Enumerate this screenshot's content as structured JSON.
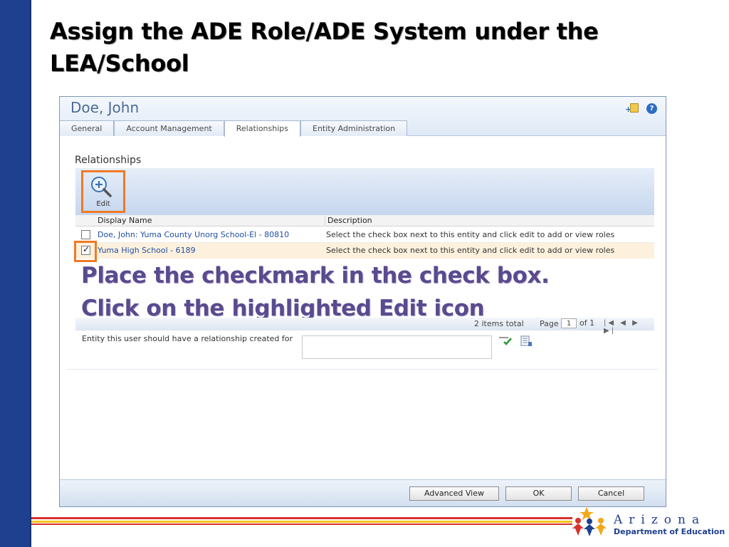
{
  "slide": {
    "title": "Assign the ADE Role/ADE System under the LEA/School"
  },
  "window": {
    "title": "Doe, John",
    "header_icons": [
      "add-note-icon",
      "help-icon"
    ],
    "tabs": [
      {
        "label": "General",
        "active": false
      },
      {
        "label": "Account Management",
        "active": false
      },
      {
        "label": "Relationships",
        "active": true
      },
      {
        "label": "Entity Administration",
        "active": false
      }
    ]
  },
  "relationships": {
    "section_label": "Relationships",
    "edit_label": "Edit",
    "columns": [
      "Display Name",
      "Description"
    ],
    "rows": [
      {
        "name": "Doe, John: Yuma County Unorg School-El - 80810",
        "description": "Select the check box next to this entity and click edit to add or view roles",
        "checked": false
      },
      {
        "name": "Yuma High School - 6189",
        "description": "Select the check box next to this entity and click edit to add or view roles",
        "checked": true
      }
    ]
  },
  "callout": {
    "line1": "Place the checkmark in the check box.",
    "line2": "Click on the highlighted Edit icon"
  },
  "pager": {
    "total": "2 items total",
    "page_label": "Page",
    "page_value": "1",
    "of_label": "of 1",
    "nav": "|◀ ◀ ▶ ▶|"
  },
  "entity": {
    "label": "Entity this user should have a relationship created for",
    "input_value": ""
  },
  "footer": {
    "advanced_view": "Advanced View",
    "ok": "OK",
    "cancel": "Cancel"
  },
  "logo": {
    "word": "Arizona",
    "sub": "Department of Education"
  },
  "colors": {
    "highlight": "#f07a25",
    "callout": "#5a4a8e",
    "left_bar": "#1f3f8f",
    "link": "#1f4fa3"
  }
}
